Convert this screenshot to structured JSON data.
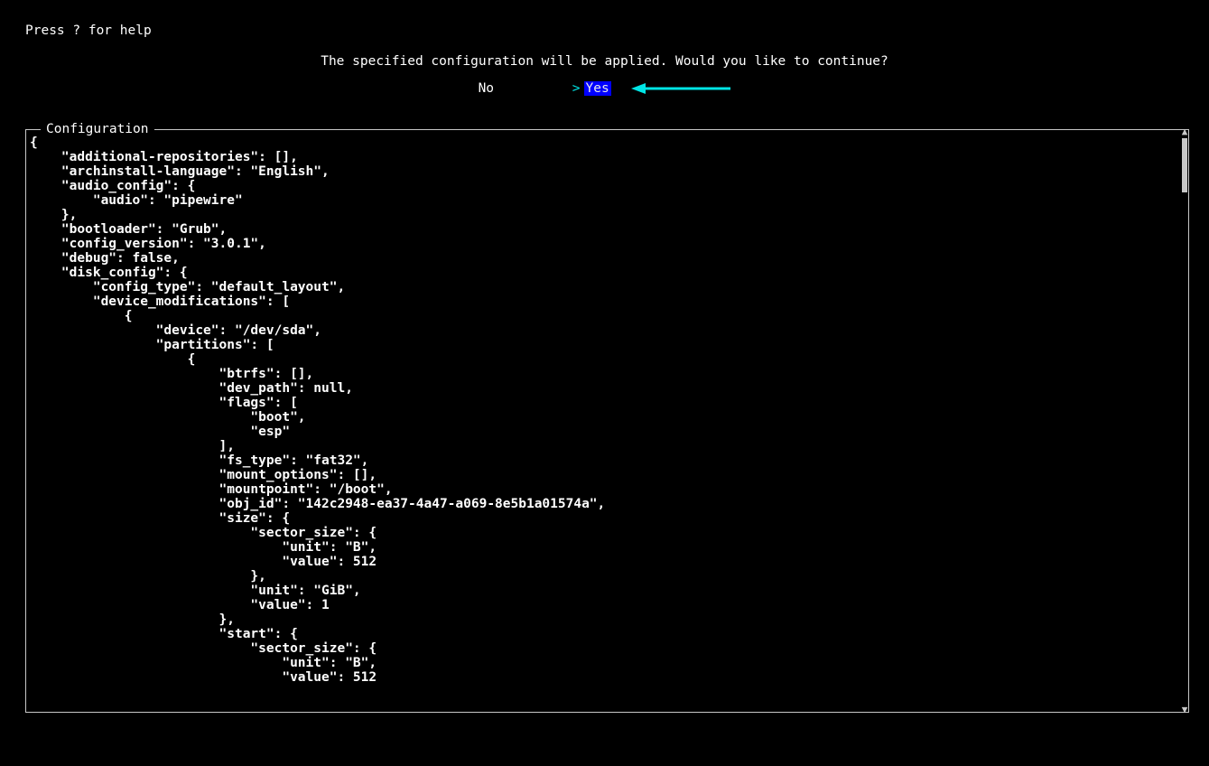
{
  "help_hint": "Press ? for help",
  "prompt": "The specified configuration will be applied. Would you like to continue?",
  "choices": {
    "no_label": "No",
    "yes_label": "Yes",
    "selected_prefix": ">"
  },
  "panel": {
    "title": "Configuration",
    "body": "{\n    \"additional-repositories\": [],\n    \"archinstall-language\": \"English\",\n    \"audio_config\": {\n        \"audio\": \"pipewire\"\n    },\n    \"bootloader\": \"Grub\",\n    \"config_version\": \"3.0.1\",\n    \"debug\": false,\n    \"disk_config\": {\n        \"config_type\": \"default_layout\",\n        \"device_modifications\": [\n            {\n                \"device\": \"/dev/sda\",\n                \"partitions\": [\n                    {\n                        \"btrfs\": [],\n                        \"dev_path\": null,\n                        \"flags\": [\n                            \"boot\",\n                            \"esp\"\n                        ],\n                        \"fs_type\": \"fat32\",\n                        \"mount_options\": [],\n                        \"mountpoint\": \"/boot\",\n                        \"obj_id\": \"142c2948-ea37-4a47-a069-8e5b1a01574a\",\n                        \"size\": {\n                            \"sector_size\": {\n                                \"unit\": \"B\",\n                                \"value\": 512\n                            },\n                            \"unit\": \"GiB\",\n                            \"value\": 1\n                        },\n                        \"start\": {\n                            \"sector_size\": {\n                                \"unit\": \"B\",\n                                \"value\": 512"
  },
  "colors": {
    "cyan": "#00e5e5",
    "selection_bg": "#0000ff"
  }
}
